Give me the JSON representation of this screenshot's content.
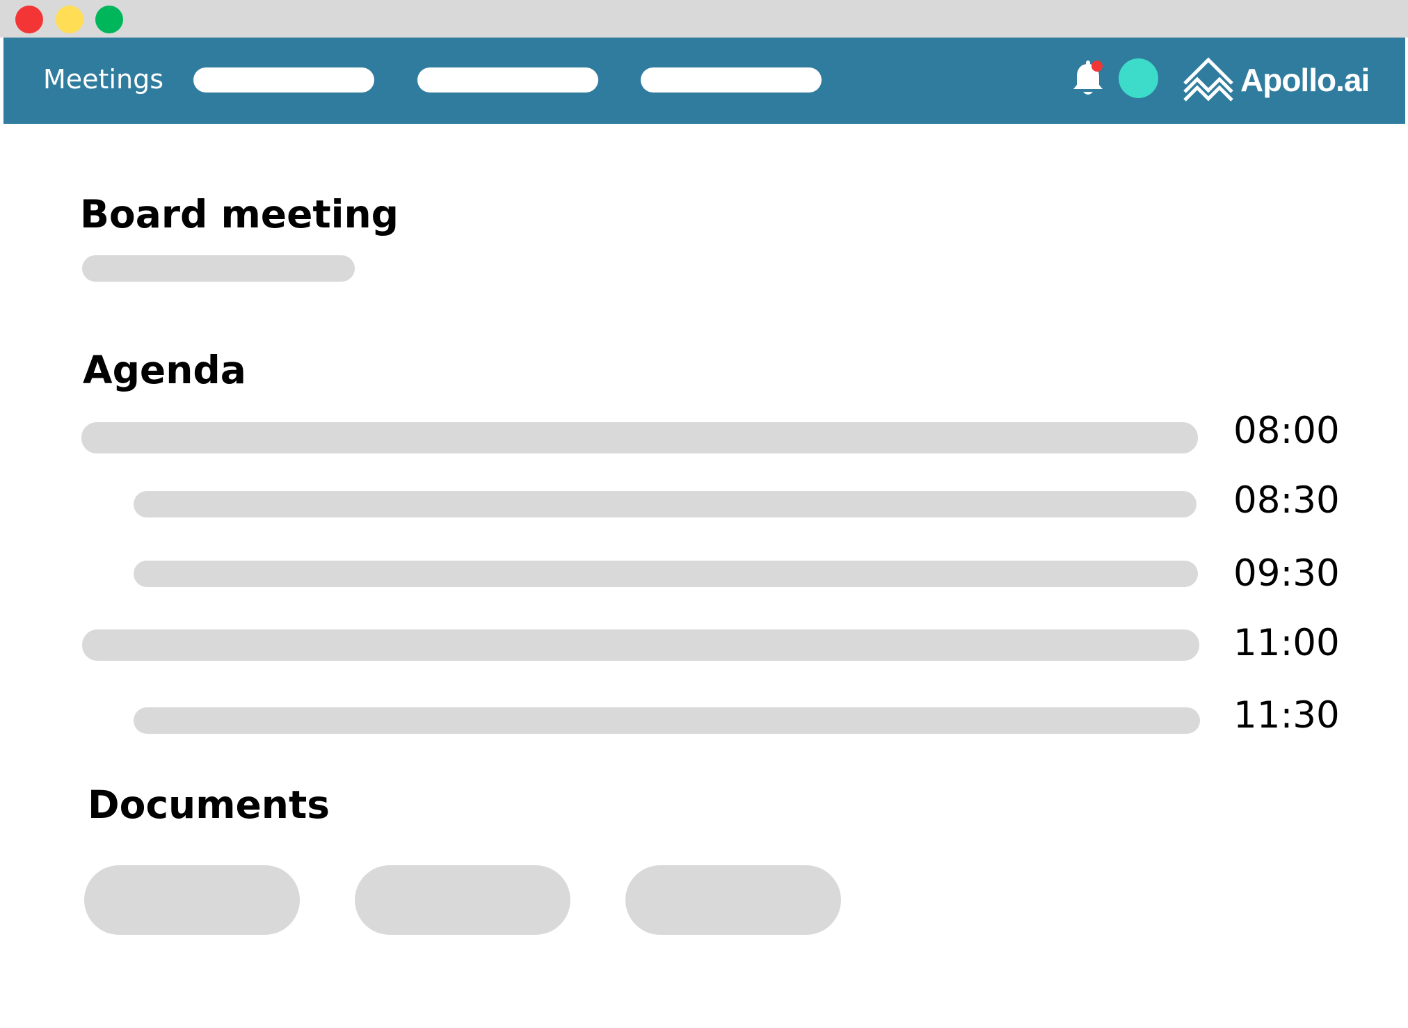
{
  "window": {
    "controls": {
      "close_color": "#f33535",
      "minimize_color": "#ffdd55",
      "maximize_color": "#00b65a"
    }
  },
  "nav": {
    "background": "#2f7c9e",
    "meetings_label": "Meetings",
    "icons": {
      "bell": "bell-icon",
      "notification_dot_color": "#f33535",
      "avatar_color": "#3ddbc9"
    },
    "logo_text": "Apollo.ai"
  },
  "meeting": {
    "title": "Board meeting"
  },
  "agenda": {
    "heading": "Agenda",
    "items": [
      {
        "time": "08:00",
        "level": 0
      },
      {
        "time": "08:30",
        "level": 1
      },
      {
        "time": "09:30",
        "level": 1
      },
      {
        "time": "11:00",
        "level": 0
      },
      {
        "time": "11:30",
        "level": 1
      }
    ]
  },
  "documents": {
    "heading": "Documents"
  },
  "colors": {
    "placeholder": "#d9d9d9",
    "page_background": "#ffffff"
  }
}
